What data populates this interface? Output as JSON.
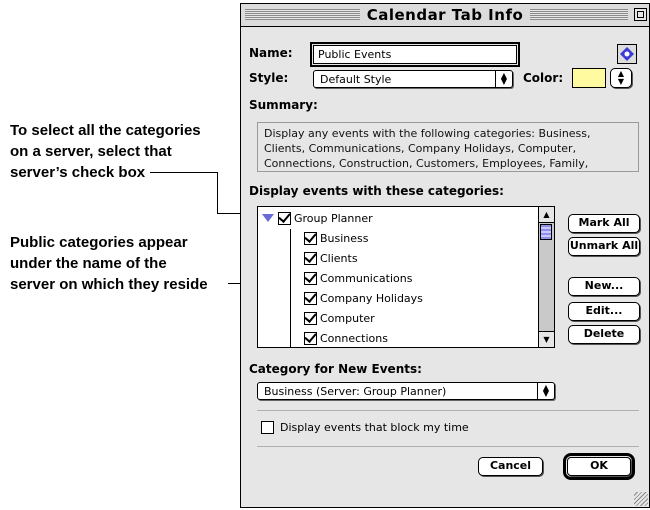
{
  "callouts": {
    "categories_note": [
      "To select all the categories",
      "on a server, select that",
      "server’s check box"
    ],
    "public_note": [
      "Public categories appear",
      "under the name of the",
      "server on which they reside"
    ]
  },
  "window": {
    "title": "Calendar Tab Info"
  },
  "form": {
    "name_label": "Name:",
    "name_value": "Public Events",
    "style_label": "Style:",
    "style_value": "Default Style",
    "color_label": "Color:",
    "color_swatch": "#fffaa0",
    "summary_label": "Summary:",
    "summary_text": "Display any events with the following categories: Business, Clients, Communications, Company Holidays, Computer, Connections, Construction, Customers, Employees, Family,",
    "display_label": "Display events with these categories:"
  },
  "category_tree": {
    "server": {
      "label": "Group Planner",
      "checked": true
    },
    "items": [
      {
        "label": "Business",
        "checked": true
      },
      {
        "label": "Clients",
        "checked": true
      },
      {
        "label": "Communications",
        "checked": true
      },
      {
        "label": "Company Holidays",
        "checked": true
      },
      {
        "label": "Computer",
        "checked": true
      },
      {
        "label": "Connections",
        "checked": true
      }
    ]
  },
  "buttons": {
    "mark_all": "Mark All",
    "unmark_all": "Unmark All",
    "new": "New...",
    "edit": "Edit...",
    "delete": "Delete",
    "cancel": "Cancel",
    "ok": "OK"
  },
  "new_events": {
    "label": "Category for New Events:",
    "value": "Business (Server: Group Planner)"
  },
  "block_time": {
    "label": "Display events that block my time",
    "checked": false
  },
  "colors": {
    "accent": "#6b6bd6",
    "window_bg": "#e6e6e6"
  }
}
